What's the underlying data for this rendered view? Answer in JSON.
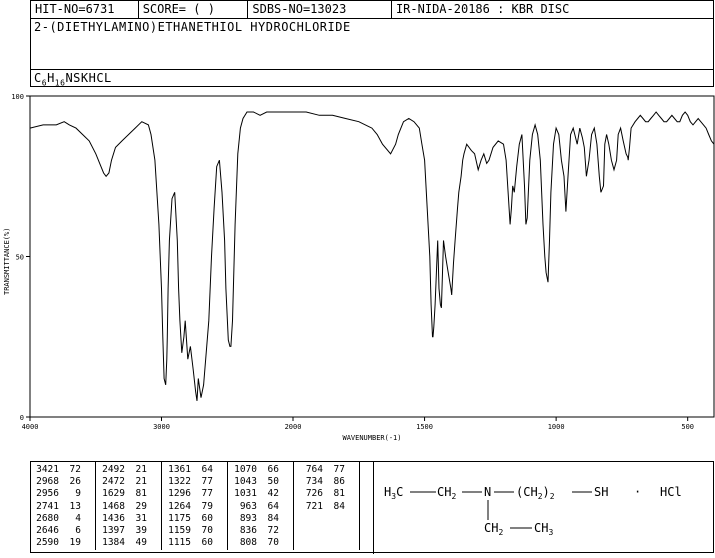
{
  "header": {
    "hit_no": "HIT-NO=6731",
    "score": "SCORE=  (   )",
    "sdbs_no": "SDBS-NO=13023",
    "ir_id": "IR-NIDA-20186 : KBR DISC"
  },
  "compound": {
    "name": "2-(DIETHYLAMINO)ETHANETHIOL HYDROCHLORIDE",
    "formula_parts": {
      "c": "C",
      "c_sub": "6",
      "h": "H",
      "h_sub": "16",
      "rest": "NSKHCL"
    }
  },
  "chart_data": {
    "type": "line",
    "xlabel": "WAVENUMBER(-1)",
    "ylabel": "TRANSMITTANCE(%)",
    "xlim": [
      4000,
      400
    ],
    "ylim": [
      0,
      100
    ],
    "x_ticks": [
      "4000",
      "3000",
      "2000",
      "1500",
      "1000",
      "500"
    ],
    "y_ticks": [
      "100",
      "50",
      "0"
    ],
    "series": [
      {
        "x": [
          4000,
          3900,
          3800,
          3740,
          3700,
          3650,
          3600,
          3550,
          3500,
          3470,
          3440,
          3421,
          3400,
          3380,
          3350,
          3300,
          3250,
          3200,
          3150,
          3100,
          3080,
          3050,
          3020,
          3000,
          2990,
          2980,
          2968,
          2960,
          2956,
          2950,
          2940,
          2920,
          2900,
          2880,
          2870,
          2860,
          2846,
          2830,
          2820,
          2800,
          2780,
          2760,
          2741,
          2730,
          2720,
          2700,
          2690,
          2680,
          2660,
          2640,
          2620,
          2600,
          2580,
          2560,
          2540,
          2520,
          2510,
          2492,
          2480,
          2472,
          2460,
          2440,
          2420,
          2400,
          2380,
          2350,
          2300,
          2250,
          2200,
          2150,
          2100,
          2050,
          2000,
          1950,
          1900,
          1850,
          1800,
          1750,
          1700,
          1680,
          1660,
          1629,
          1610,
          1600,
          1580,
          1560,
          1540,
          1520,
          1510,
          1500,
          1490,
          1480,
          1475,
          1470,
          1468,
          1465,
          1460,
          1455,
          1450,
          1445,
          1440,
          1436,
          1432,
          1428,
          1420,
          1410,
          1400,
          1397,
          1390,
          1384,
          1375,
          1370,
          1361,
          1355,
          1350,
          1340,
          1322,
          1310,
          1296,
          1285,
          1275,
          1264,
          1255,
          1240,
          1220,
          1200,
          1190,
          1175,
          1170,
          1165,
          1159,
          1150,
          1140,
          1130,
          1120,
          1115,
          1110,
          1100,
          1090,
          1080,
          1070,
          1060,
          1050,
          1043,
          1038,
          1031,
          1025,
          1020,
          1010,
          1000,
          990,
          980,
          970,
          963,
          955,
          945,
          935,
          920,
          910,
          900,
          893,
          885,
          875,
          865,
          855,
          845,
          836,
          830,
          820,
          815,
          808,
          800,
          790,
          780,
          770,
          764,
          755,
          745,
          734,
          728,
          726,
          721,
          715,
          700,
          690,
          680,
          670,
          660,
          650,
          640,
          630,
          620,
          610,
          600,
          590,
          580,
          570,
          560,
          550,
          540,
          530,
          520,
          510,
          500,
          490,
          480,
          470,
          460,
          450,
          440,
          430,
          420,
          410,
          400
        ],
        "y": [
          90,
          91,
          91,
          92,
          91,
          90,
          88,
          86,
          82,
          79,
          76,
          75,
          76,
          80,
          84,
          86,
          88,
          90,
          92,
          91,
          88,
          80,
          60,
          40,
          25,
          12,
          10,
          18,
          25,
          40,
          55,
          68,
          70,
          55,
          40,
          30,
          20,
          25,
          30,
          18,
          22,
          15,
          8,
          5,
          12,
          6,
          8,
          10,
          20,
          30,
          50,
          65,
          78,
          80,
          70,
          55,
          40,
          24,
          22,
          22,
          30,
          60,
          82,
          90,
          93,
          95,
          95,
          94,
          95,
          95,
          95,
          95,
          95,
          95,
          94,
          94,
          93,
          92,
          90,
          88,
          85,
          82,
          85,
          88,
          92,
          93,
          92,
          90,
          85,
          80,
          65,
          50,
          35,
          25,
          25,
          28,
          35,
          45,
          55,
          40,
          35,
          34,
          45,
          55,
          50,
          45,
          40,
          38,
          48,
          55,
          65,
          70,
          75,
          80,
          82,
          85,
          83,
          82,
          77,
          80,
          82,
          79,
          80,
          84,
          86,
          85,
          80,
          60,
          65,
          72,
          70,
          78,
          85,
          88,
          72,
          60,
          62,
          80,
          88,
          91,
          88,
          80,
          60,
          50,
          45,
          42,
          55,
          70,
          85,
          90,
          88,
          80,
          75,
          64,
          75,
          88,
          90,
          85,
          90,
          87,
          84,
          75,
          80,
          88,
          90,
          85,
          75,
          70,
          72,
          85,
          88,
          85,
          80,
          77,
          80,
          88,
          90,
          86,
          82,
          81,
          80,
          84,
          90,
          92,
          93,
          94,
          93,
          92,
          92,
          93,
          94,
          95,
          94,
          93,
          92,
          92,
          93,
          94,
          93,
          92,
          92,
          94,
          95,
          94,
          92,
          91,
          92,
          93,
          92,
          91,
          90,
          88,
          86,
          85
        ]
      }
    ]
  },
  "peaks": [
    [
      [
        "3421",
        "72"
      ],
      [
        "2968",
        "26"
      ],
      [
        "2956",
        "9"
      ],
      [
        "2741",
        "13"
      ],
      [
        "2680",
        "4"
      ],
      [
        "2646",
        "6"
      ],
      [
        "2590",
        "19"
      ]
    ],
    [
      [
        "2492",
        "21"
      ],
      [
        "2472",
        "21"
      ],
      [
        "1629",
        "81"
      ],
      [
        "1468",
        "29"
      ],
      [
        "1436",
        "31"
      ],
      [
        "1397",
        "39"
      ],
      [
        "1384",
        "49"
      ]
    ],
    [
      [
        "1361",
        "64"
      ],
      [
        "1322",
        "77"
      ],
      [
        "1296",
        "77"
      ],
      [
        "1264",
        "79"
      ],
      [
        "1175",
        "60"
      ],
      [
        "1159",
        "70"
      ],
      [
        "1115",
        "60"
      ]
    ],
    [
      [
        "1070",
        "66"
      ],
      [
        "1043",
        "50"
      ],
      [
        "1031",
        "42"
      ],
      [
        "963",
        "64"
      ],
      [
        "893",
        "84"
      ],
      [
        "836",
        "72"
      ],
      [
        "808",
        "70"
      ]
    ],
    [
      [
        "764",
        "77"
      ],
      [
        "734",
        "86"
      ],
      [
        "726",
        "81"
      ],
      [
        "721",
        "84"
      ]
    ]
  ],
  "structure": {
    "line1": {
      "h3c": "H",
      "three": "3",
      "c1": "C",
      "ch2": "CH",
      "two": "2",
      "n": "N",
      "paren_ch": "(CH",
      "paren_two": "2",
      "paren_close": ")",
      "paren_two_b": "2",
      "sh": "SH",
      "dot": "·",
      "hcl": "HCl"
    },
    "line2": {
      "ch2": "CH",
      "two": "2",
      "ch3": "CH",
      "three": "3"
    }
  }
}
